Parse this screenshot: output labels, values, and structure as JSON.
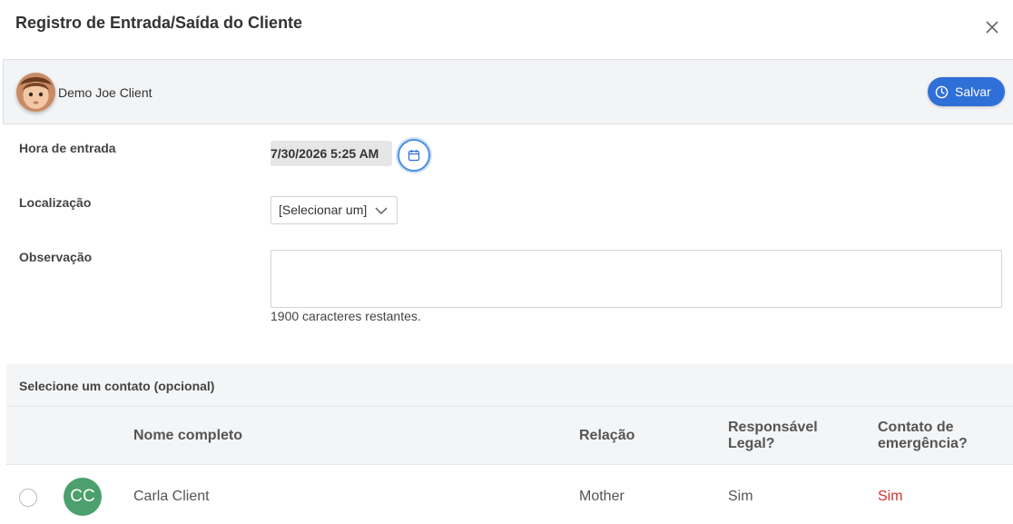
{
  "modal": {
    "title": "Registro de Entrada/Saída do Cliente"
  },
  "client": {
    "name": "Demo Joe Client",
    "save_label": "Salvar"
  },
  "form": {
    "checkin_label": "Hora de entrada",
    "checkin_value": "7/30/2026 5:25 AM",
    "location_label": "Localização",
    "location_selected": "[Selecionar um]",
    "note_label": "Observação",
    "note_value": "",
    "chars_remaining": "1900 caracteres restantes."
  },
  "contacts": {
    "title": "Selecione um contato (opcional)",
    "columns": {
      "name": "Nome completo",
      "relation": "Relação",
      "legal_1": "Responsável",
      "legal_2": "Legal?",
      "emergency_1": "Contato de",
      "emergency_2": "emergência?"
    },
    "rows": [
      {
        "initials": "CC",
        "name": "Carla Client",
        "relation": "Mother",
        "legal": "Sim",
        "emergency": "Sim"
      }
    ]
  },
  "colors": {
    "primary": "#2f6fd8",
    "initials_bg": "#4ba06d",
    "emergency_text": "#d0342c"
  }
}
